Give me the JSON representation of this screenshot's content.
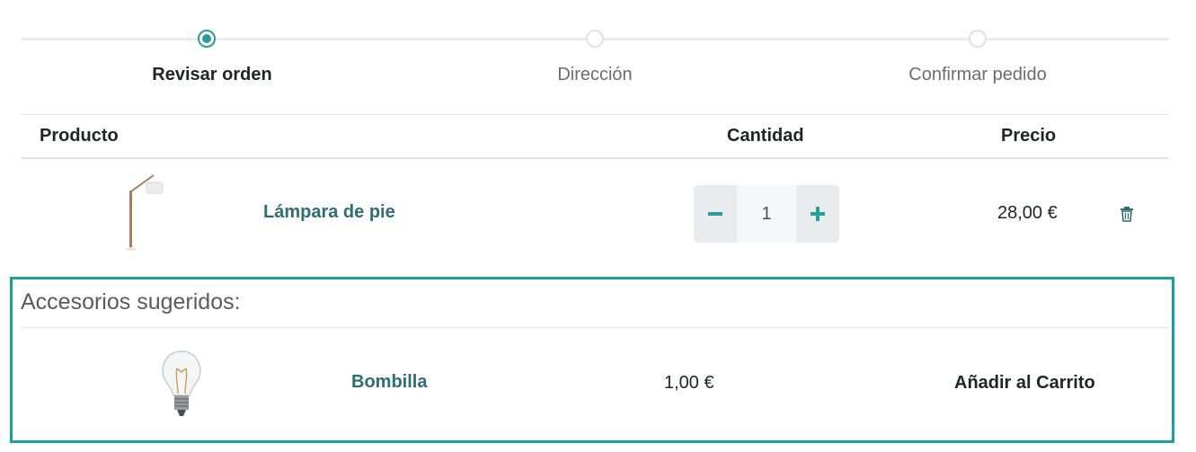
{
  "wizard": {
    "steps": [
      {
        "label": "Revisar orden",
        "state": "active"
      },
      {
        "label": "Dirección",
        "state": "pending"
      },
      {
        "label": "Confirmar pedido",
        "state": "pending"
      }
    ]
  },
  "table": {
    "headers": {
      "product": "Producto",
      "quantity": "Cantidad",
      "price": "Precio"
    },
    "rows": [
      {
        "image_icon": "floor-lamp-icon",
        "name": "Lámpara de pie",
        "quantity": "1",
        "price": "28,00 €",
        "remove_icon": "trash-icon"
      }
    ]
  },
  "quantity_controls": {
    "minus_icon": "minus-icon",
    "plus_icon": "plus-icon"
  },
  "suggestions": {
    "title": "Accesorios sugeridos:",
    "items": [
      {
        "image_icon": "light-bulb-icon",
        "name": "Bombilla",
        "price": "1,00 €",
        "action_label": "Añadir al Carrito"
      }
    ]
  },
  "colors": {
    "accent": "#2a9d98",
    "link": "#2d6e73",
    "highlight_border": "#16a39c"
  }
}
